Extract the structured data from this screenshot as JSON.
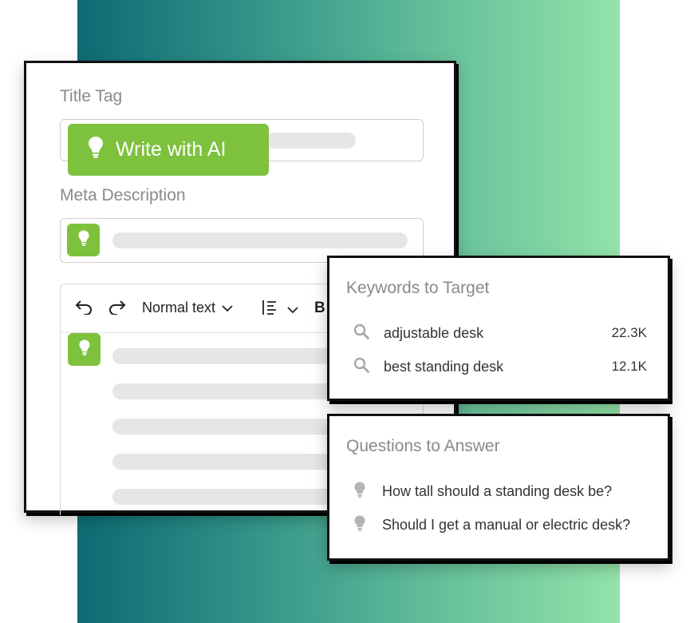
{
  "editor": {
    "title_tag_label": "Title Tag",
    "write_ai_label": "Write with AI",
    "meta_description_label": "Meta Description",
    "toolbar": {
      "text_style": "Normal text",
      "bold": "B"
    }
  },
  "keywords_panel": {
    "title": "Keywords to Target",
    "items": [
      {
        "keyword": "adjustable desk",
        "volume": "22.3K"
      },
      {
        "keyword": "best standing desk",
        "volume": "12.1K"
      }
    ]
  },
  "questions_panel": {
    "title": "Questions to Answer",
    "items": [
      {
        "question": "How tall should a standing desk be?"
      },
      {
        "question": "Should I get a manual or electric desk?"
      }
    ]
  },
  "colors": {
    "accent_green": "#7dc13c",
    "gradient_start": "#0c6b73",
    "gradient_end": "#93e3a9",
    "label_gray": "#8a8a8a"
  },
  "icons": [
    "lightbulb-icon",
    "undo-icon",
    "redo-icon",
    "chevron-down-icon",
    "line-spacing-icon",
    "search-icon"
  ]
}
